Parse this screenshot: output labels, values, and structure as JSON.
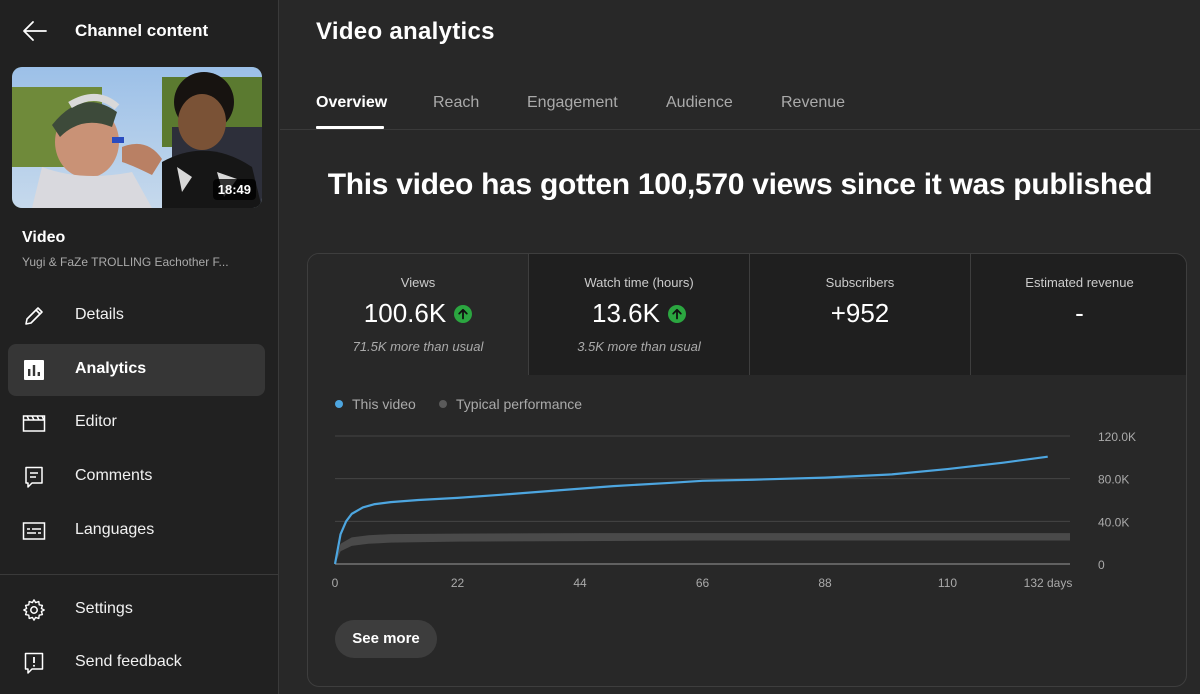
{
  "sidebar": {
    "title": "Channel content",
    "thumbnail": {
      "duration": "18:49"
    },
    "video_label": "Video",
    "video_title": "Yugi & FaZe TROLLING Eachother F...",
    "nav": [
      {
        "label": "Details",
        "icon": "pencil-icon"
      },
      {
        "label": "Analytics",
        "icon": "analytics-icon",
        "active": true
      },
      {
        "label": "Editor",
        "icon": "film-icon"
      },
      {
        "label": "Comments",
        "icon": "comment-icon"
      },
      {
        "label": "Languages",
        "icon": "subtitles-icon"
      }
    ],
    "footer_nav": [
      {
        "label": "Settings",
        "icon": "gear-icon"
      },
      {
        "label": "Send feedback",
        "icon": "feedback-icon"
      }
    ]
  },
  "main": {
    "title": "Video analytics",
    "tabs": [
      {
        "label": "Overview",
        "active": true
      },
      {
        "label": "Reach"
      },
      {
        "label": "Engagement"
      },
      {
        "label": "Audience"
      },
      {
        "label": "Revenue"
      }
    ],
    "headline": "This video has gotten 100,570 views since it was published",
    "metrics": [
      {
        "title": "Views",
        "value": "100.6K",
        "trend": "up",
        "note": "71.5K more than usual"
      },
      {
        "title": "Watch time (hours)",
        "value": "13.6K",
        "trend": "up",
        "note": "3.5K more than usual"
      },
      {
        "title": "Subscribers",
        "value": "+952",
        "note": ""
      },
      {
        "title": "Estimated revenue",
        "value": "-",
        "note": ""
      }
    ],
    "see_more_label": "See more"
  },
  "colors": {
    "this_video": "#4da6e0",
    "typical": "#5a5a5a",
    "trend_up": "#2ba640"
  },
  "chart_data": {
    "type": "line",
    "legend": [
      "This video",
      "Typical performance"
    ],
    "legend_position": "top-left",
    "x_ticks": [
      "0",
      "22",
      "44",
      "66",
      "88",
      "110",
      "132 days"
    ],
    "y_ticks": [
      "120.0K",
      "80.0K",
      "40.0K",
      "0"
    ],
    "xlim": [
      0,
      132
    ],
    "ylim": [
      0,
      120000
    ],
    "grid": true,
    "series": [
      {
        "name": "This video",
        "x": [
          0,
          1,
          2,
          3,
          5,
          7,
          10,
          15,
          22,
          30,
          40,
          50,
          60,
          66,
          75,
          88,
          100,
          110,
          120,
          128
        ],
        "values": [
          0,
          28000,
          40000,
          47000,
          53000,
          56000,
          58000,
          60000,
          62000,
          65000,
          69000,
          73000,
          76000,
          78000,
          79000,
          81000,
          84000,
          89000,
          95000,
          100600
        ]
      },
      {
        "name": "Typical performance",
        "x": [
          0,
          1,
          3,
          6,
          10,
          22,
          44,
          66,
          88,
          110,
          132
        ],
        "low": [
          0,
          12000,
          17000,
          19000,
          20000,
          21000,
          21500,
          22000,
          22000,
          22000,
          22000
        ],
        "high": [
          0,
          19000,
          25000,
          27000,
          28000,
          28500,
          29000,
          29000,
          29000,
          29000,
          29000
        ]
      }
    ]
  }
}
